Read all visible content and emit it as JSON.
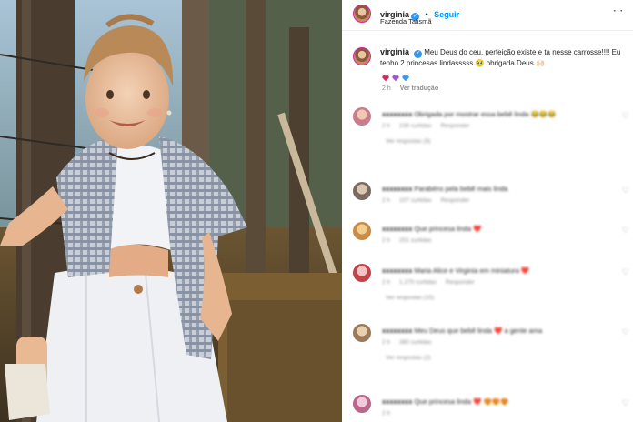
{
  "post": {
    "username": "virginia",
    "follow_label": "Seguir",
    "dot": "•",
    "location": "Fazenda Talismã",
    "more_icon": "ellipsis-icon",
    "verified_icon": "verified-badge-icon"
  },
  "caption": {
    "username": "virginia",
    "text": "Meu Deus do ceu, perfeição existe e ta nesse carrosse!!!! Eu tenho 2 princesas lindasssss 🥹 obrigada Deus 🙌🏻",
    "hearts": [
      "#e0245e",
      "#9b59d0",
      "#3897f0"
    ],
    "time": "2 h",
    "translate_label": "Ver tradução"
  },
  "comments": [
    {
      "username": "xxxxxxxx",
      "text": "Obrigada por mostrar essa bebê linda 😂😂😂",
      "time": "2 h",
      "likes": "238 curtidas",
      "reply_label": "Responder",
      "replies_label": "Ver respostas (9)"
    },
    {
      "username": "xxxxxxxx",
      "text": "Parabéns pela bebê mais linda",
      "time": "2 h",
      "likes": "107 curtidas",
      "reply_label": "Responder",
      "replies_label": ""
    },
    {
      "username": "xxxxxxxx",
      "text": "Que princesa linda ❤️",
      "time": "2 h",
      "likes": "201 curtidas",
      "reply_label": "",
      "replies_label": ""
    },
    {
      "username": "xxxxxxxx",
      "text": "Maria Alice e Virginia em miniatura ❤️",
      "time": "2 h",
      "likes": "1.270 curtidas",
      "reply_label": "Responder",
      "replies_label": "Ver respostas (15)"
    },
    {
      "username": "xxxxxxxx",
      "text": "Meu Deus que bebê linda ❤️ a gente ama",
      "time": "2 h",
      "likes": "380 curtidas",
      "reply_label": "",
      "replies_label": "Ver respostas (2)"
    },
    {
      "username": "xxxxxxxx",
      "text": "Que princesa linda ❤️ 😍😍😍",
      "time": "2 h",
      "likes": "",
      "reply_label": "",
      "replies_label": ""
    }
  ]
}
